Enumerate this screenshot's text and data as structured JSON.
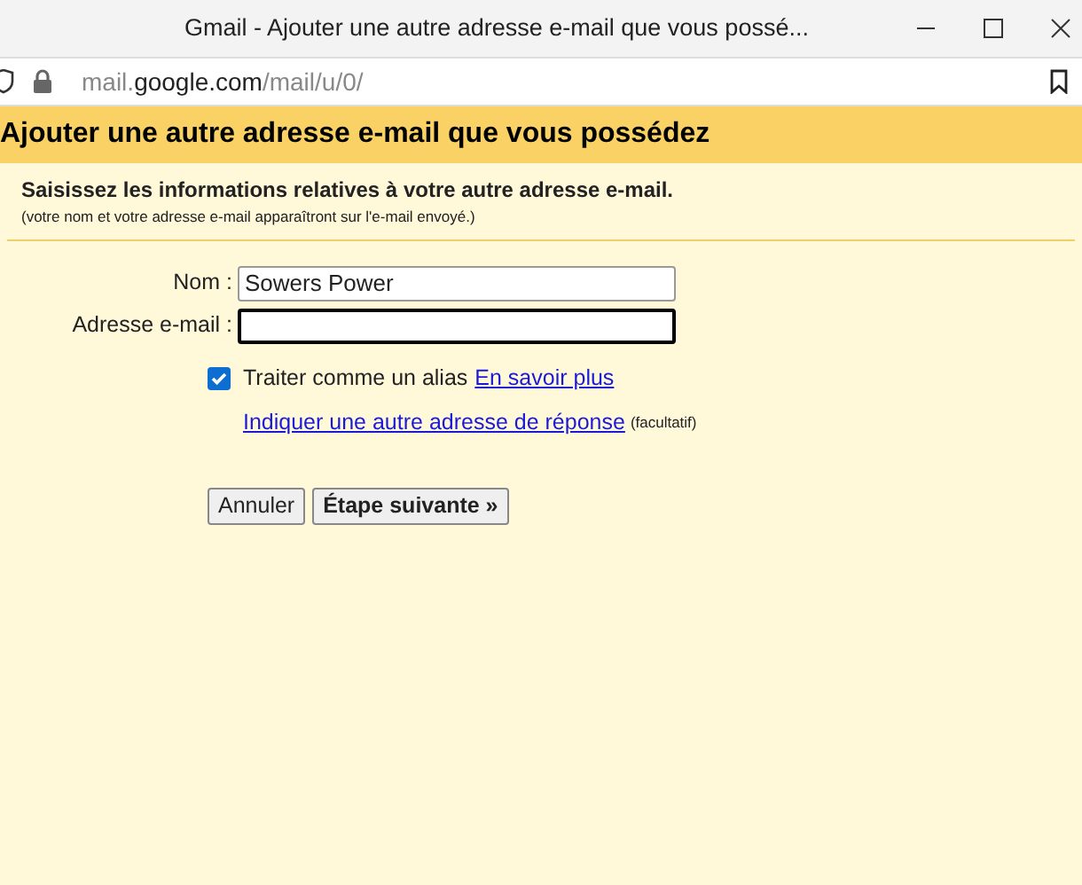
{
  "window": {
    "title": "Gmail - Ajouter une autre adresse e-mail que vous possé..."
  },
  "address_bar": {
    "url_start": "mail.",
    "url_domain": "google.com",
    "url_path": "/mail/u/0/"
  },
  "header": {
    "title": "Ajouter une autre adresse e-mail que vous possédez"
  },
  "intro": {
    "heading": "Saisissez les informations relatives à votre autre adresse e-mail.",
    "note": "(votre nom et votre adresse e-mail apparaîtront sur l'e-mail envoyé.)"
  },
  "fields": [
    {
      "label": "Nom :",
      "value": "Sowers Power",
      "focused": false
    },
    {
      "label": "Adresse e-mail :",
      "focused": true
    }
  ],
  "alias": {
    "label": "Traiter comme un alias",
    "checked": true,
    "link": "En savoir plus"
  },
  "reply_to": {
    "link": "Indiquer une autre adresse de réponse",
    "note": "(facultatif)"
  },
  "buttons": [
    {
      "label": "Annuler",
      "primary": false
    },
    {
      "label": "Étape suivante »",
      "primary": true
    }
  ]
}
